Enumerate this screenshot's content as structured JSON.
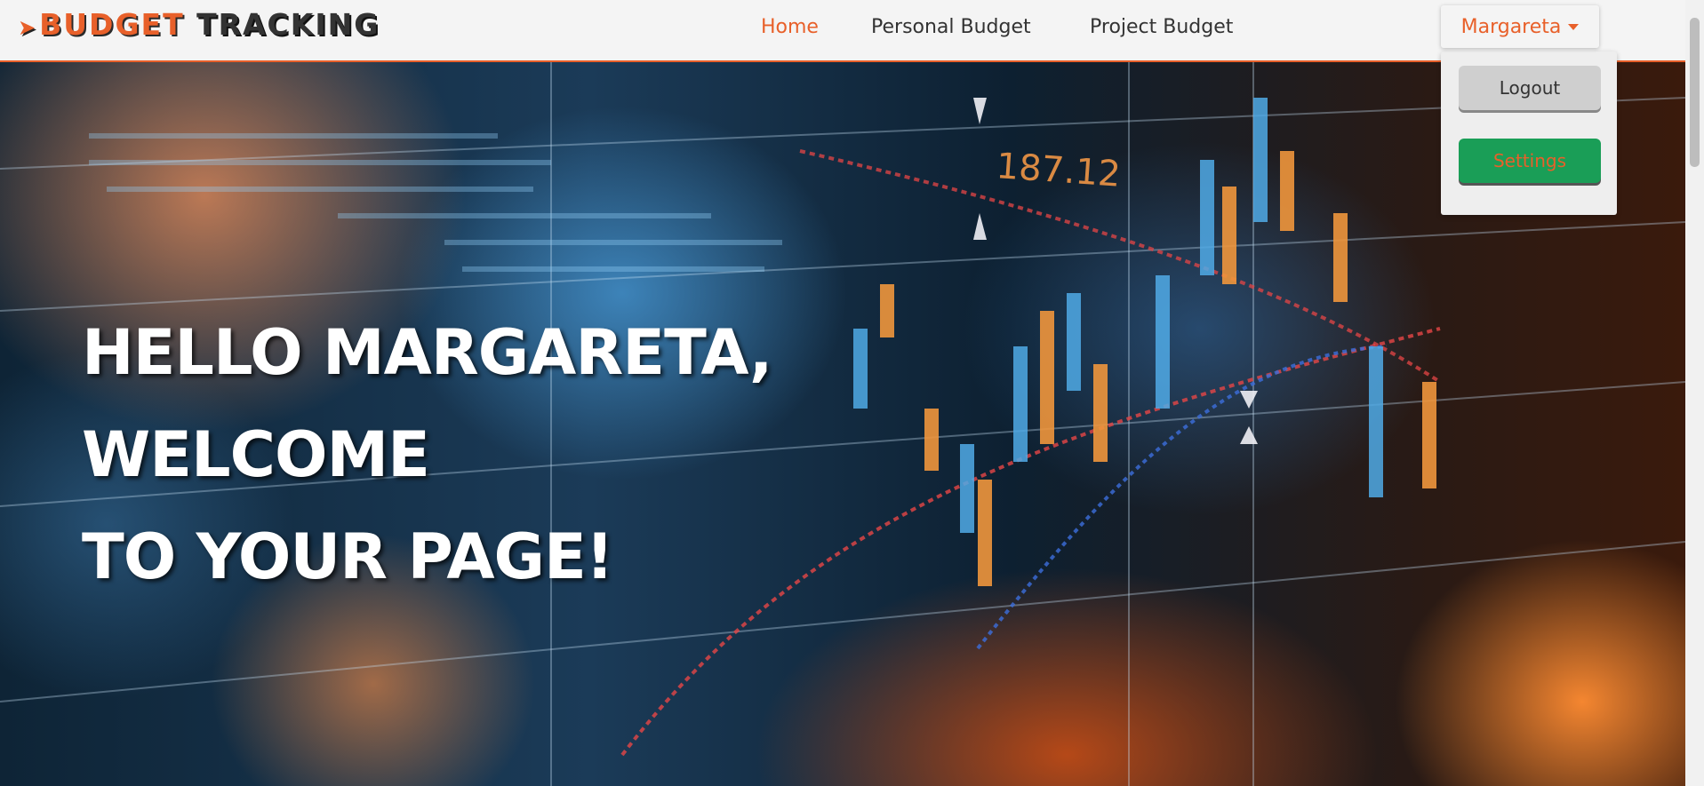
{
  "navbar": {
    "brand_part1": "BUDGET",
    "brand_part2": "TRACKING",
    "brand_icon": "chevron-right-icon",
    "links": [
      {
        "label": "Home",
        "active": true
      },
      {
        "label": "Personal Budget",
        "active": false
      },
      {
        "label": "Project Budget",
        "active": false
      }
    ],
    "user": {
      "name": "Margareta",
      "menu": {
        "logout_label": "Logout",
        "settings_label": "Settings"
      }
    }
  },
  "hero": {
    "line1": "HELLO MARGARETA,",
    "line2": "WELCOME",
    "line3": "TO YOUR PAGE!",
    "background_label": "187.12"
  },
  "colors": {
    "accent": "#e8602a",
    "navbar_bg": "#f4f4f4",
    "settings_button": "#1a9e57",
    "logout_button": "#cfcfcf",
    "hero_text": "#ffffff"
  }
}
